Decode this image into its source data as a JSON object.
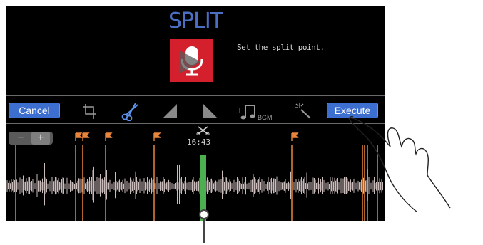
{
  "header": {
    "title": "SPLIT",
    "instruction": "Set the split point."
  },
  "toolbar": {
    "cancel_label": "Cancel",
    "execute_label": "Execute",
    "bgm_label": "BGM",
    "tools": [
      "crop-icon",
      "scissors-icon",
      "fade-in-icon",
      "fade-out-icon",
      "add-bgm-icon",
      "magic-wand-icon"
    ]
  },
  "timeline": {
    "zoom_out_label": "−",
    "zoom_in_label": "+",
    "split_time": "16:43",
    "marker_count": 7,
    "playhead_position": 0.52
  },
  "colors": {
    "accent": "#3c6fd0",
    "title": "#4a6fc2",
    "marker": "#e8853a",
    "playhead": "#4caf50",
    "waveform": "#cbbcbc",
    "thumbnail": "#d3202c"
  }
}
